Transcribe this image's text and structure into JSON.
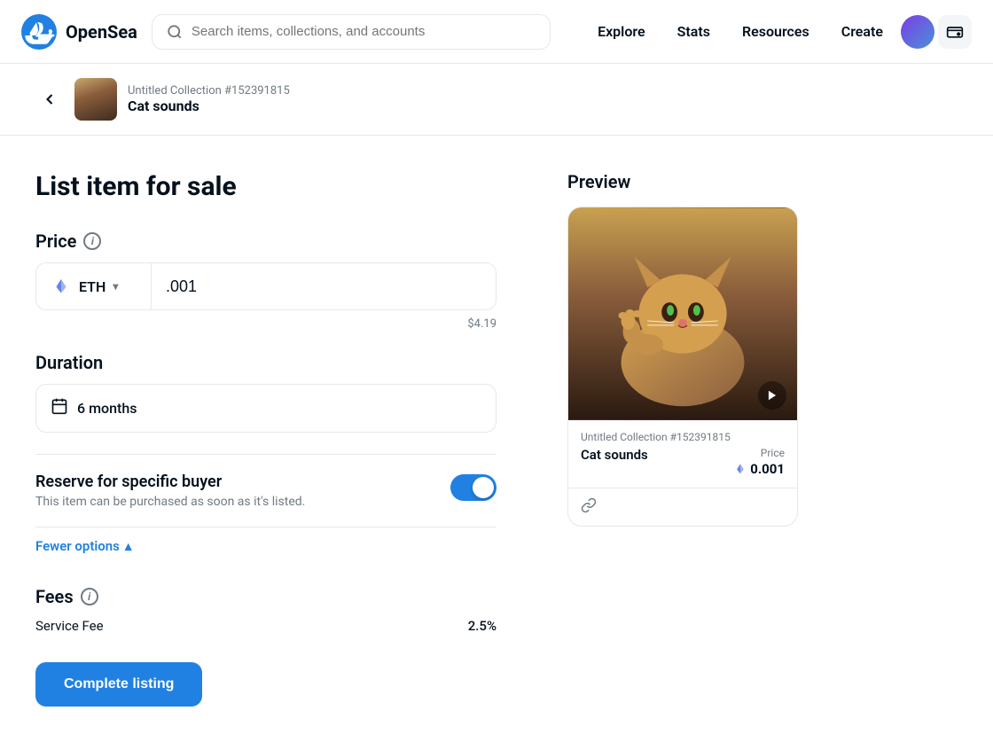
{
  "app": {
    "name": "OpenSea"
  },
  "nav": {
    "search_placeholder": "Search items, collections, and accounts",
    "links": [
      "Explore",
      "Stats",
      "Resources",
      "Create"
    ]
  },
  "breadcrumb": {
    "back_label": "←",
    "collection": "Untitled Collection #152391815",
    "item_name": "Cat sounds"
  },
  "page": {
    "title": "List item for sale"
  },
  "price": {
    "label": "Price",
    "currency": "ETH",
    "value": ".001",
    "usd_equiv": "$4.19"
  },
  "duration": {
    "label": "Duration",
    "value": "6 months"
  },
  "reserve": {
    "title": "Reserve for specific buyer",
    "description": "This item can be purchased as soon as it's listed.",
    "enabled": true
  },
  "fewer_options": {
    "label": "Fewer options"
  },
  "fees": {
    "label": "Fees",
    "service_fee_label": "Service Fee",
    "service_fee_value": "2.5%"
  },
  "complete_button": {
    "label": "Complete listing"
  },
  "preview": {
    "title": "Preview",
    "collection": "Untitled Collection #152391815",
    "nft_name": "Cat sounds",
    "price_label": "Price",
    "price_value": "0.001"
  },
  "icons": {
    "search": "🔍",
    "calendar": "📅",
    "info": "i",
    "play": "▶",
    "link": "🔗",
    "chevron_down": "▾",
    "chevron_up": "▴",
    "back": "‹"
  }
}
